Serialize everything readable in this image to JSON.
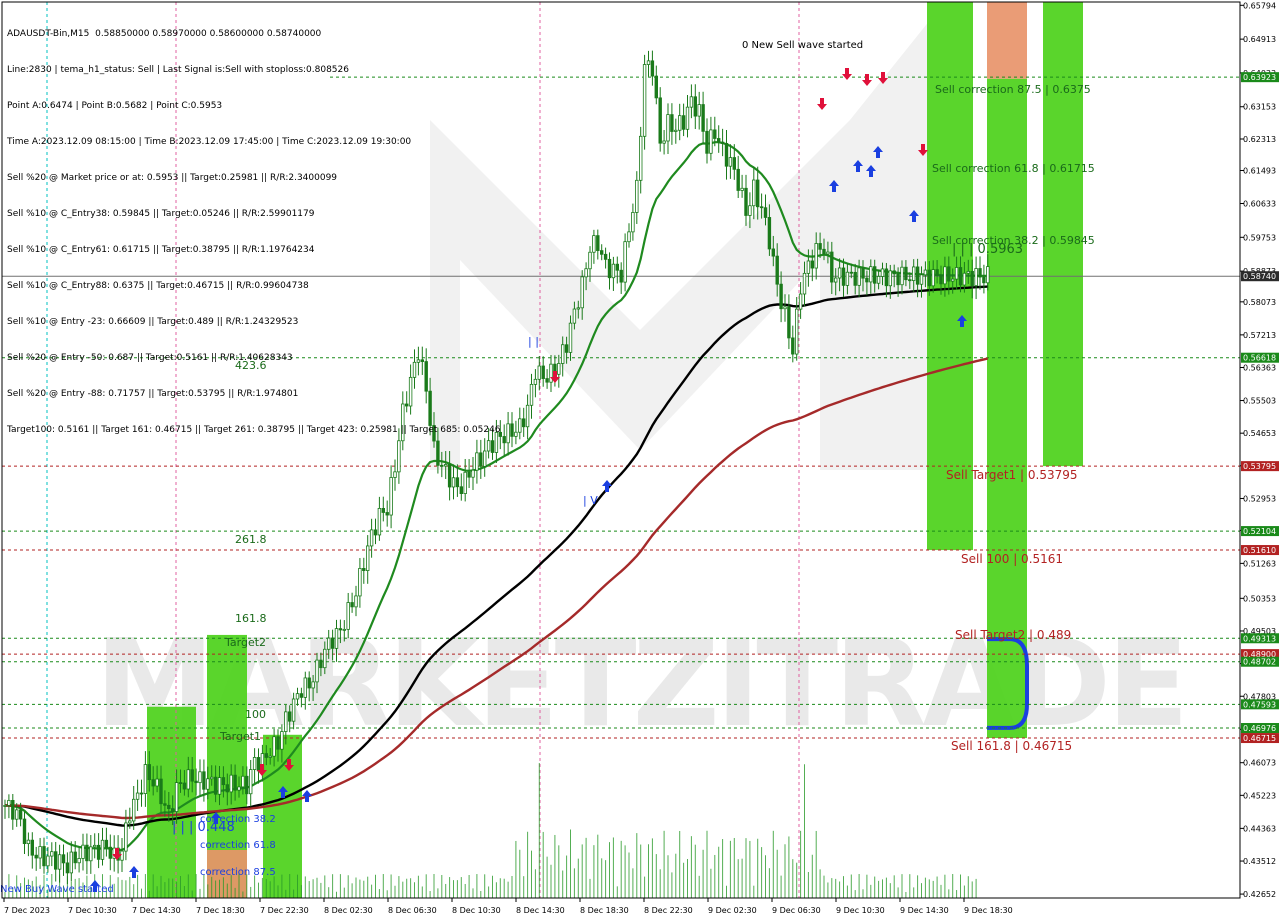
{
  "info_lines": [
    "ADAUSDT-Bin,M15  0.58850000 0.58970000 0.58600000 0.58740000",
    "Line:2830 | tema_h1_status: Sell | Last Signal is:Sell with stoploss:0.808526",
    "Point A:0.6474 | Point B:0.5682 | Point C:0.5953",
    "Time A:2023.12.09 08:15:00 | Time B:2023.12.09 17:45:00 | Time C:2023.12.09 19:30:00",
    "Sell %20 @ Market price or at: 0.5953 || Target:0.25981 || R/R:2.3400099",
    "Sell %10 @ C_Entry38: 0.59845 || Target:0.05246 || R/R:2.59901179",
    "Sell %10 @ C_Entry61: 0.61715 || Target:0.38795 || R/R:1.19764234",
    "Sell %10 @ C_Entry88: 0.6375 || Target:0.46715 || R/R:0.99604738",
    "Sell %10 @ Entry -23: 0.66609 || Target:0.489 || R/R:1.24329523",
    "Sell %20 @ Entry -50: 0.687 || Target:0.5161 || R/R:1.40628343",
    "Sell %20 @ Entry -88: 0.71757 || Target:0.53795 || R/R:1.974801",
    "Target100: 0.5161 || Target 161: 0.46715 || Target 261: 0.38795 || Target 423: 0.25981 || Target 685: 0.05246"
  ],
  "colors": {
    "hline_green": "#1a8a1a",
    "hline_red": "#b22222",
    "bright_green": "#4cd11a",
    "orange": "#e8946a",
    "ema_green": "#1f8a1f",
    "ema_black": "#000000",
    "ema_darkred": "#a52a2a",
    "candle": "#1a7a1a",
    "arrow_up": "#1a3fe0",
    "arrow_down": "#e0103a",
    "current_price_bg": "#2b2b2b",
    "watermark": "#d8d8d8"
  },
  "chart_data": {
    "type": "candlestick",
    "symbol": "ADAUSDT-Bin",
    "timeframe": "M15",
    "ohlc_last": {
      "open": 0.5885,
      "high": 0.5897,
      "low": 0.586,
      "close": 0.5874
    },
    "ylim": [
      0.4255,
      0.6588
    ],
    "y_ticks": [
      "0.65794",
      "0.64913",
      "0.64033",
      "0.63153",
      "0.62313",
      "0.61493",
      "0.60633",
      "0.59753",
      "0.58873",
      "0.58073",
      "0.57213",
      "0.56363",
      "0.55503",
      "0.54653",
      "0.53803",
      "0.52953",
      "0.52123",
      "0.51263",
      "0.50353",
      "0.49503",
      "0.48653",
      "0.47803",
      "0.46943",
      "0.46073",
      "0.45223",
      "0.44363",
      "0.43512",
      "0.42652"
    ],
    "x_ticks": [
      "7 Dec 2023",
      "7 Dec 10:30",
      "7 Dec 14:30",
      "7 Dec 18:30",
      "7 Dec 22:30",
      "8 Dec 02:30",
      "8 Dec 06:30",
      "8 Dec 10:30",
      "8 Dec 14:30",
      "8 Dec 18:30",
      "8 Dec 22:30",
      "9 Dec 02:30",
      "9 Dec 06:30",
      "9 Dec 10:30",
      "9 Dec 14:30",
      "9 Dec 18:30"
    ],
    "price_tags": [
      {
        "value": 0.63923,
        "label": "0.63923",
        "color": "green"
      },
      {
        "value": 0.5874,
        "label": "0.58740",
        "color": "current"
      },
      {
        "value": 0.56618,
        "label": "0.56618",
        "color": "green"
      },
      {
        "value": 0.53795,
        "label": "0.53795",
        "color": "red"
      },
      {
        "value": 0.52104,
        "label": "0.52104",
        "color": "green"
      },
      {
        "value": 0.5161,
        "label": "0.51610",
        "color": "red"
      },
      {
        "value": 0.49313,
        "label": "0.49313",
        "color": "green"
      },
      {
        "value": 0.489,
        "label": "0.48900",
        "color": "red"
      },
      {
        "value": 0.48702,
        "label": "0.48702",
        "color": "green"
      },
      {
        "value": 0.47593,
        "label": "0.47593",
        "color": "green"
      },
      {
        "value": 0.46976,
        "label": "0.46976",
        "color": "green"
      },
      {
        "value": 0.46715,
        "label": "0.46715",
        "color": "red"
      }
    ],
    "levels": [
      {
        "value": 0.63923,
        "color": "green",
        "from_x": "8 Dec 2023"
      },
      {
        "value": 0.56618,
        "color": "green"
      },
      {
        "value": 0.53795,
        "color": "red"
      },
      {
        "value": 0.52104,
        "color": "green"
      },
      {
        "value": 0.5161,
        "color": "red"
      },
      {
        "value": 0.49313,
        "color": "green"
      },
      {
        "value": 0.489,
        "color": "red"
      },
      {
        "value": 0.48702,
        "color": "green"
      },
      {
        "value": 0.47593,
        "color": "green"
      },
      {
        "value": 0.46976,
        "color": "green"
      },
      {
        "value": 0.46715,
        "color": "red"
      }
    ],
    "annotations": [
      {
        "text": "0 New Sell wave started",
        "color": "#000000"
      },
      {
        "text": "Sell correction 87.5 | 0.6375",
        "color": "#1a6a1a"
      },
      {
        "text": "Sell correction 61.8 | 0.61715",
        "color": "#1a6a1a"
      },
      {
        "text": "Sell correction 38.2 | 0.59845",
        "color": "#1a6a1a"
      },
      {
        "text": "| | | 0.5963",
        "color": "#1a6a1a"
      },
      {
        "text": "Sell Target1 | 0.53795",
        "color": "#b22222"
      },
      {
        "text": "Sell 100 | 0.5161",
        "color": "#b22222"
      },
      {
        "text": "Sell Target2 | 0.489",
        "color": "#b22222"
      },
      {
        "text": "Sell 161.8 | 0.46715",
        "color": "#b22222"
      },
      {
        "text": "423.6",
        "color": "#1a6a1a"
      },
      {
        "text": "261.8",
        "color": "#1a6a1a"
      },
      {
        "text": "161.8",
        "color": "#1a6a1a"
      },
      {
        "text": "Target2",
        "color": "#1a6a1a"
      },
      {
        "text": "100",
        "color": "#1a6a1a"
      },
      {
        "text": "Target1",
        "color": "#1a6a1a"
      },
      {
        "text": "correction 38.2",
        "color": "#1a3fe0"
      },
      {
        "text": "correction 61.8",
        "color": "#1a3fe0"
      },
      {
        "text": "correction 87.5",
        "color": "#1a3fe0"
      },
      {
        "text": "| | | 0.448",
        "color": "#1a3fe0"
      },
      {
        "text": "New Buy Wave started",
        "color": "#1a3fe0"
      },
      {
        "text": "| |",
        "color": "#1a3fe0"
      },
      {
        "text": "| V",
        "color": "#1a3fe0"
      }
    ],
    "watermark": "MARKETZITRADE",
    "series": [
      {
        "name": "",
        "kind": "close",
        "x": [
          0,
          2,
          4,
          6,
          8,
          10,
          12,
          14,
          16,
          18,
          20,
          22,
          24,
          26,
          28,
          30,
          32,
          34,
          36,
          38,
          40,
          42,
          44,
          46,
          48,
          50,
          52,
          54,
          56,
          58,
          60,
          62,
          64,
          66,
          68,
          70,
          72,
          74,
          76,
          78,
          80,
          82,
          84,
          86,
          88,
          90,
          92,
          94,
          96,
          98,
          100,
          102,
          104,
          106,
          108,
          110,
          112,
          114,
          116,
          118,
          120,
          122,
          124,
          126,
          128,
          130,
          132,
          134,
          136,
          138,
          140,
          142,
          144,
          146,
          148,
          150,
          152,
          154,
          156,
          158,
          160,
          162,
          164,
          166,
          168,
          170,
          172,
          174,
          176,
          178,
          180,
          182,
          184,
          186,
          188,
          190,
          192,
          194,
          196,
          198,
          200,
          202,
          204,
          206,
          208,
          210,
          212,
          214,
          216,
          218,
          220,
          222,
          224,
          226,
          228,
          230,
          232,
          234,
          236,
          238,
          240,
          242,
          244,
          246,
          248,
          250,
          252,
          254
        ],
        "values": [
          0.4496,
          0.4485,
          0.4455,
          0.4382,
          0.437,
          0.436,
          0.436,
          0.435,
          0.434,
          0.436,
          0.437,
          0.438,
          0.438,
          0.439,
          0.436,
          0.438,
          0.448,
          0.452,
          0.458,
          0.456,
          0.452,
          0.447,
          0.454,
          0.456,
          0.457,
          0.456,
          0.456,
          0.455,
          0.455,
          0.455,
          0.455,
          0.455,
          0.461,
          0.461,
          0.464,
          0.466,
          0.472,
          0.476,
          0.48,
          0.481,
          0.485,
          0.49,
          0.493,
          0.495,
          0.5,
          0.505,
          0.513,
          0.52,
          0.525,
          0.527,
          0.538,
          0.552,
          0.56,
          0.568,
          0.558,
          0.542,
          0.538,
          0.535,
          0.532,
          0.534,
          0.538,
          0.54,
          0.543,
          0.545,
          0.546,
          0.547,
          0.548,
          0.553,
          0.563,
          0.561,
          0.562,
          0.565,
          0.57,
          0.578,
          0.585,
          0.595,
          0.596,
          0.59,
          0.589,
          0.588,
          0.6,
          0.61,
          0.642,
          0.642,
          0.622,
          0.627,
          0.626,
          0.628,
          0.633,
          0.63,
          0.621,
          0.625,
          0.62,
          0.617,
          0.612,
          0.604,
          0.61,
          0.605,
          0.597,
          0.585,
          0.577,
          0.568,
          0.585,
          0.59,
          0.594,
          0.595,
          0.5874,
          0.5874,
          0.5874,
          0.5874,
          0.5874,
          0.5874,
          0.5874,
          0.5874,
          0.5874,
          0.5874,
          0.5874,
          0.5874,
          0.5874,
          0.5874,
          0.5874,
          0.5874,
          0.5874,
          0.5874,
          0.5874,
          0.5874,
          0.5874,
          0.5874
        ]
      }
    ]
  }
}
